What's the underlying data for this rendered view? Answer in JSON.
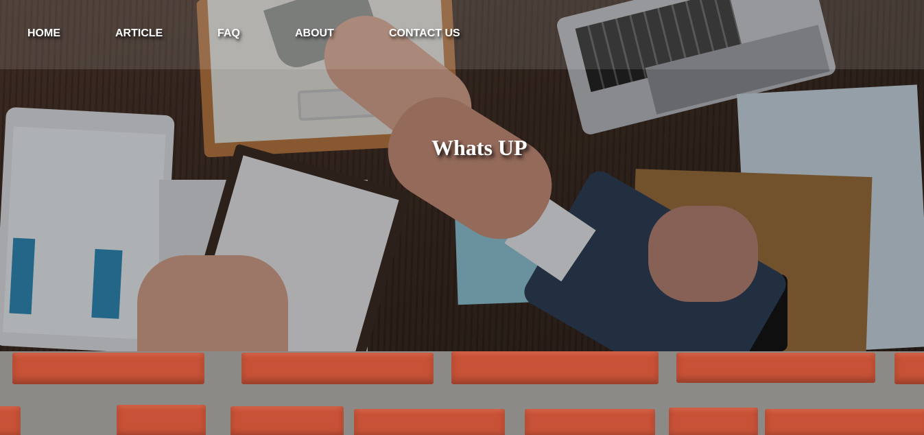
{
  "nav": {
    "items": [
      {
        "label": "HOME"
      },
      {
        "label": "ARTICLE"
      },
      {
        "label": "FAQ"
      },
      {
        "label": "ABOUT"
      },
      {
        "label": "CONTACT US"
      }
    ]
  },
  "hero": {
    "title": "Whats UP"
  },
  "colors": {
    "nav_text": "#ffffff",
    "brick": "#c85237",
    "mortar": "#8c8a86"
  }
}
